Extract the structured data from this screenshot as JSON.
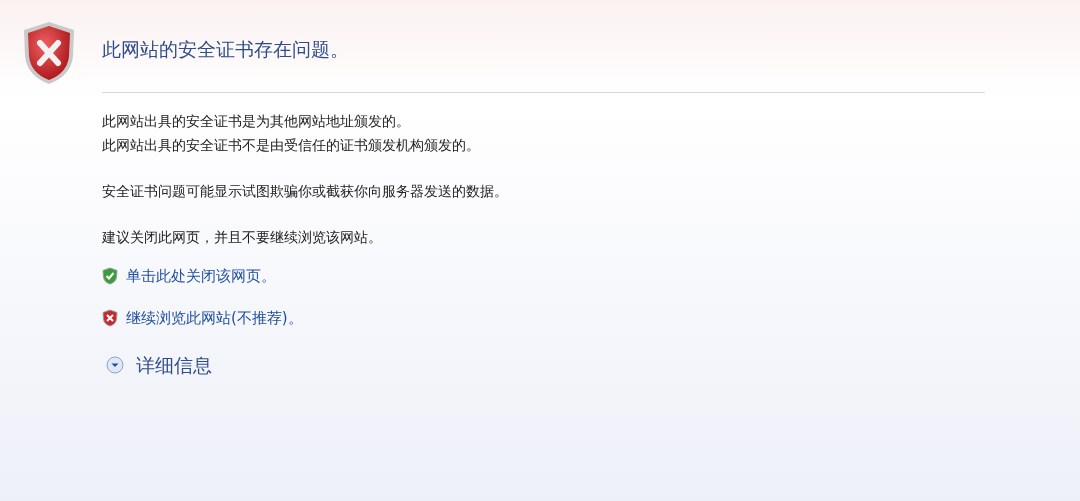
{
  "title": "此网站的安全证书存在问题。",
  "paragraphs": [
    [
      "此网站出具的安全证书是为其他网站地址颁发的。",
      "此网站出具的安全证书不是由受信任的证书颁发机构颁发的。"
    ],
    [
      "安全证书问题可能显示试图欺骗你或截获你向服务器发送的数据。"
    ],
    [
      "建议关闭此网页，并且不要继续浏览该网站。"
    ]
  ],
  "links": [
    {
      "kind": "safe",
      "label": "单击此处关闭该网页。"
    },
    {
      "kind": "unsafe",
      "label": "继续浏览此网站(不推荐)。"
    }
  ],
  "details": {
    "label": "详细信息",
    "expanded": false
  }
}
